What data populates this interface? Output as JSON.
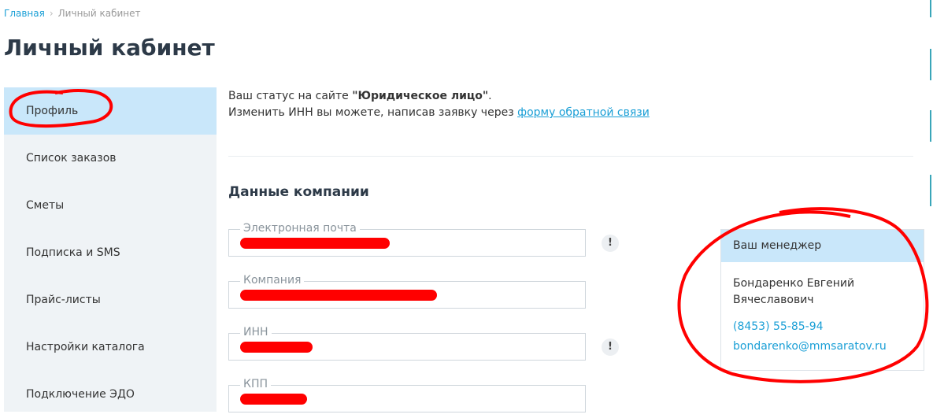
{
  "breadcrumb": {
    "home": "Главная",
    "current": "Личный кабинет"
  },
  "page_title": "Личный кабинет",
  "sidebar": {
    "items": [
      {
        "label": "Профиль",
        "active": true
      },
      {
        "label": "Список заказов"
      },
      {
        "label": "Сметы"
      },
      {
        "label": "Подписка и SMS"
      },
      {
        "label": "Прайс-листы"
      },
      {
        "label": "Настройки каталога"
      },
      {
        "label": "Подключение ЭДО"
      }
    ]
  },
  "status": {
    "prefix": "Ваш статус на сайте ",
    "value": "\"Юридическое лицо\"",
    "suffix": ".",
    "inn_text": "Изменить ИНН вы можете, написав заявку через ",
    "inn_link": "форму обратной связи"
  },
  "company": {
    "section_title": "Данные компании",
    "fields": [
      {
        "label": "Электронная почта",
        "value_redacted": true,
        "has_alert": true
      },
      {
        "label": "Компания",
        "value_redacted": true,
        "has_alert": false
      },
      {
        "label": "ИНН",
        "value_redacted": true,
        "has_alert": true
      },
      {
        "label": "КПП",
        "value_redacted": true,
        "has_alert": false
      }
    ],
    "alert_symbol": "!"
  },
  "manager": {
    "title": "Ваш менеджер",
    "name": "Бондаренко Евгений Вячеславович",
    "phone": "(8453) 55-85-94",
    "email": "bondarenko@mmsaratov.ru"
  },
  "colors": {
    "accent_link": "#1a9fd6",
    "active_bg": "#c9e7fa",
    "sidebar_bg": "#eff3f6",
    "annotation": "#ff0000"
  }
}
